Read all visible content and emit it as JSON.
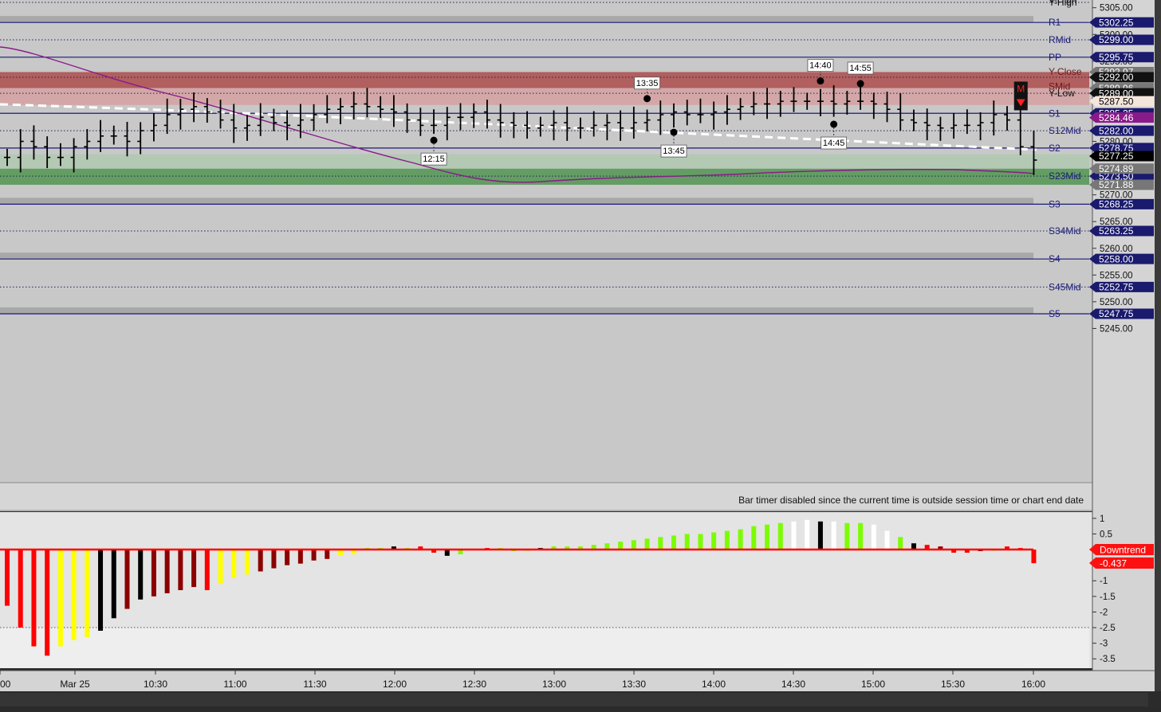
{
  "colors": {
    "price_bg": "#c8c8c8",
    "osc_bg": "#e4e4e4",
    "level_line": "#1a1a7a",
    "badge_blue": "#1a1a6e",
    "resistance_zone": "#b05a5a",
    "support_zone": "#5a9a5a",
    "vwap": "#8a1a8a",
    "bar": "#000000",
    "osc_red": "#ff0000",
    "osc_yellow": "#ffff00",
    "osc_darkred": "#8b0000",
    "osc_green": "#7cfc00",
    "osc_white": "#ffffff",
    "osc_black": "#000000"
  },
  "status_message": "Bar timer disabled since the current time is outside session time or chart end date",
  "chart_data": [
    {
      "type": "bar",
      "subtype": "ohlc",
      "x_ticks": [
        "00",
        "Mar 25",
        "10:30",
        "11:00",
        "11:30",
        "12:00",
        "12:30",
        "13:00",
        "13:30",
        "14:00",
        "14:30",
        "15:00",
        "15:30",
        "16:00"
      ],
      "y_ticks": [
        5245,
        5250,
        5255,
        5260,
        5265,
        5270,
        5275,
        5280,
        5285,
        5290,
        5295,
        5300,
        5305
      ],
      "ylim": [
        5242.5,
        5306
      ],
      "grid": true,
      "levels": [
        {
          "label": "Y-High",
          "value": 5306.0,
          "value_text": "5306.00",
          "style": "dotted",
          "show_badge": false
        },
        {
          "label": "R1",
          "value": 5302.25,
          "value_text": "5302.25",
          "style": "solid",
          "show_badge": true
        },
        {
          "label": "RMid",
          "value": 5299.0,
          "value_text": "5299.00",
          "style": "dotted",
          "show_badge": true
        },
        {
          "label": "PP",
          "value": 5295.75,
          "value_text": "5295.75",
          "style": "solid",
          "show_badge": true
        },
        {
          "label": "Y-Close",
          "value": 5292.0,
          "value_text": "5292.00",
          "style": "dotted",
          "show_badge": false
        },
        {
          "label": "SMid",
          "value": 5289.96,
          "value_text": "5289.96",
          "style": "none",
          "show_badge": false
        },
        {
          "label": "Y-Low",
          "value": 5289.0,
          "value_text": "5289.00",
          "style": "dotted",
          "show_badge": false
        },
        {
          "label": "S1",
          "value": 5285.25,
          "value_text": "5285.25",
          "style": "solid",
          "show_badge": false
        },
        {
          "label": "S12Mid",
          "value": 5282.0,
          "value_text": "5282.00",
          "style": "dotted",
          "show_badge": true
        },
        {
          "label": "S2",
          "value": 5278.75,
          "value_text": "5278.75",
          "style": "solid",
          "show_badge": false
        },
        {
          "label": "S23Mid",
          "value": 5273.5,
          "value_text": "5273.50",
          "style": "dotted",
          "show_badge": true
        },
        {
          "label": "S3",
          "value": 5268.25,
          "value_text": "5268.25",
          "style": "solid",
          "show_badge": true
        },
        {
          "label": "S34Mid",
          "value": 5263.25,
          "value_text": "5263.25",
          "style": "dotted",
          "show_badge": true
        },
        {
          "label": "S4",
          "value": 5258.0,
          "value_text": "5258.00",
          "style": "solid",
          "show_badge": true
        },
        {
          "label": "S45Mid",
          "value": 5252.75,
          "value_text": "5252.75",
          "style": "dotted",
          "show_badge": true
        },
        {
          "label": "S5",
          "value": 5247.75,
          "value_text": "5247.75",
          "style": "solid",
          "show_badge": true
        }
      ],
      "extra_badges": [
        {
          "text": "5292.97",
          "value": 5292.97,
          "color": "#777777",
          "text_color": "#ffffff"
        },
        {
          "text": "5292.00",
          "value": 5292.0,
          "color": "#111111",
          "text_color": "#ffffff"
        },
        {
          "text": "5289.96",
          "value": 5289.96,
          "color": "#777777",
          "text_color": "#ffffff"
        },
        {
          "text": "5289.00",
          "value": 5289.0,
          "color": "#111111",
          "text_color": "#ffffff"
        },
        {
          "text": "5287.50",
          "value": 5287.5,
          "color": "#f5e6dc",
          "text_color": "#000000"
        },
        {
          "text": "5285.25",
          "value": 5285.25,
          "color": "#1a1a6e",
          "text_color": "#ffffff"
        },
        {
          "text": "5284.46",
          "value": 5284.46,
          "color": "#8a1a8a",
          "text_color": "#ffffff"
        },
        {
          "text": "5278.75",
          "value": 5278.75,
          "color": "#1a1a6e",
          "text_color": "#ffffff"
        },
        {
          "text": "5277.25",
          "value": 5277.25,
          "color": "#000000",
          "text_color": "#ffffff"
        },
        {
          "text": "5274.89",
          "value": 5274.89,
          "color": "#777777",
          "text_color": "#ffffff"
        },
        {
          "text": "5271.88",
          "value": 5271.88,
          "color": "#777777",
          "text_color": "#ffffff"
        }
      ],
      "zones": [
        {
          "from": 5289.96,
          "to": 5292.97,
          "kind": "resistance-dark"
        },
        {
          "from": 5286.8,
          "to": 5289.96,
          "kind": "resistance-light"
        },
        {
          "from": 5274.89,
          "to": 5277.6,
          "kind": "support-light"
        },
        {
          "from": 5271.88,
          "to": 5274.89,
          "kind": "support-dark"
        }
      ],
      "pivot_markers": [
        {
          "label": "12:15",
          "x_slot": 32,
          "price": 5280.2,
          "label_pos": "below"
        },
        {
          "label": "13:35",
          "x_slot": 48,
          "price": 5288.0,
          "label_pos": "above"
        },
        {
          "label": "13:45",
          "x_slot": 50,
          "price": 5281.7,
          "label_pos": "below"
        },
        {
          "label": "14:40",
          "x_slot": 61,
          "price": 5291.3,
          "label_pos": "above"
        },
        {
          "label": "14:45",
          "x_slot": 62,
          "price": 5283.2,
          "label_pos": "below"
        },
        {
          "label": "14:55",
          "x_slot": 64,
          "price": 5290.8,
          "label_pos": "above"
        }
      ],
      "signal_marker": {
        "text": "M",
        "x_slot": 76,
        "price": 5288.2
      }
    },
    {
      "type": "bar",
      "subtype": "oscillator",
      "y_ticks": [
        1,
        0.5,
        -1,
        -1.5,
        -2,
        -2.5,
        -3,
        -3.5
      ],
      "y_tick_labels": [
        "1",
        "0.5",
        "-1",
        "-1.5",
        "-2",
        "-2.5",
        "-3",
        "-3.5"
      ],
      "ylim": [
        -3.8,
        1.2
      ],
      "trend_label": "Downtrend",
      "current_value": -0.437,
      "current_value_text": "-0.437",
      "values": [
        -1.8,
        -2.5,
        -3.1,
        -3.4,
        -3.1,
        -2.9,
        -2.8,
        -2.6,
        -2.2,
        -1.9,
        -1.6,
        -1.5,
        -1.4,
        -1.3,
        -1.2,
        -1.3,
        -1.1,
        -0.9,
        -0.8,
        -0.7,
        -0.6,
        -0.5,
        -0.45,
        -0.35,
        -0.3,
        -0.2,
        -0.15,
        0.05,
        0.05,
        0.1,
        0.05,
        0.1,
        -0.1,
        -0.2,
        -0.15,
        0.02,
        0.05,
        0.05,
        -0.05,
        0.0,
        0.05,
        0.1,
        0.1,
        0.1,
        0.15,
        0.2,
        0.25,
        0.3,
        0.35,
        0.4,
        0.45,
        0.5,
        0.5,
        0.55,
        0.6,
        0.65,
        0.75,
        0.8,
        0.85,
        0.9,
        0.95,
        0.9,
        0.9,
        0.85,
        0.85,
        0.8,
        0.6,
        0.4,
        0.2,
        0.15,
        0.1,
        -0.1,
        -0.1,
        -0.05,
        -0.02,
        0.1,
        0.05,
        -0.437
      ],
      "bar_colors": [
        "red",
        "red",
        "red",
        "red",
        "yellow",
        "yellow",
        "yellow",
        "black",
        "black",
        "darkred",
        "black",
        "darkred",
        "darkred",
        "darkred",
        "darkred",
        "red",
        "yellow",
        "yellow",
        "yellow",
        "darkred",
        "darkred",
        "darkred",
        "darkred",
        "darkred",
        "darkred",
        "yellow",
        "yellow",
        "green",
        "green",
        "black",
        "green",
        "red",
        "red",
        "black",
        "green",
        "black",
        "red",
        "green",
        "green",
        "green",
        "black",
        "green",
        "green",
        "green",
        "green",
        "green",
        "green",
        "green",
        "green",
        "green",
        "green",
        "green",
        "green",
        "green",
        "green",
        "green",
        "green",
        "green",
        "green",
        "white",
        "white",
        "black",
        "white",
        "green",
        "green",
        "white",
        "white",
        "green",
        "black",
        "red",
        "darkred",
        "red",
        "red",
        "darkred",
        "green",
        "red",
        "red",
        "red"
      ],
      "zero_line_color": "#ff0000",
      "ref_line": -2.5
    }
  ]
}
